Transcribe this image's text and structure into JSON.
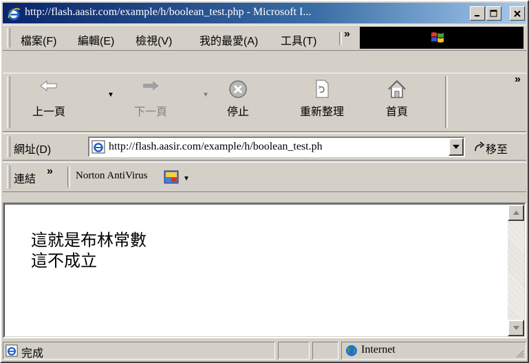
{
  "window": {
    "title": "http://flash.aasir.com/example/h/boolean_test.php - Microsoft I...",
    "minimize": "_",
    "maximize": "□",
    "close": "✕"
  },
  "menu": {
    "items": [
      "檔案(F)",
      "編輯(E)",
      "檢視(V)",
      "我的最愛(A)",
      "工具(T)"
    ],
    "more": "»"
  },
  "toolbar": {
    "back": "上一頁",
    "forward": "下一頁",
    "stop": "停止",
    "refresh": "重新整理",
    "home": "首頁",
    "more": "»"
  },
  "address": {
    "label": "網址(D)",
    "url": "http://flash.aasir.com/example/h/boolean_test.ph",
    "go": "移至"
  },
  "links": {
    "label": "連結",
    "more": "»",
    "norton": "Norton AntiVirus"
  },
  "page": {
    "line1": "這就是布林常數",
    "line2": "這不成立"
  },
  "status": {
    "text": "完成",
    "zone": "Internet"
  },
  "colors": {
    "titlebar_start": "#0a246a",
    "titlebar_end": "#a6caf0",
    "face": "#d4d0c8"
  }
}
